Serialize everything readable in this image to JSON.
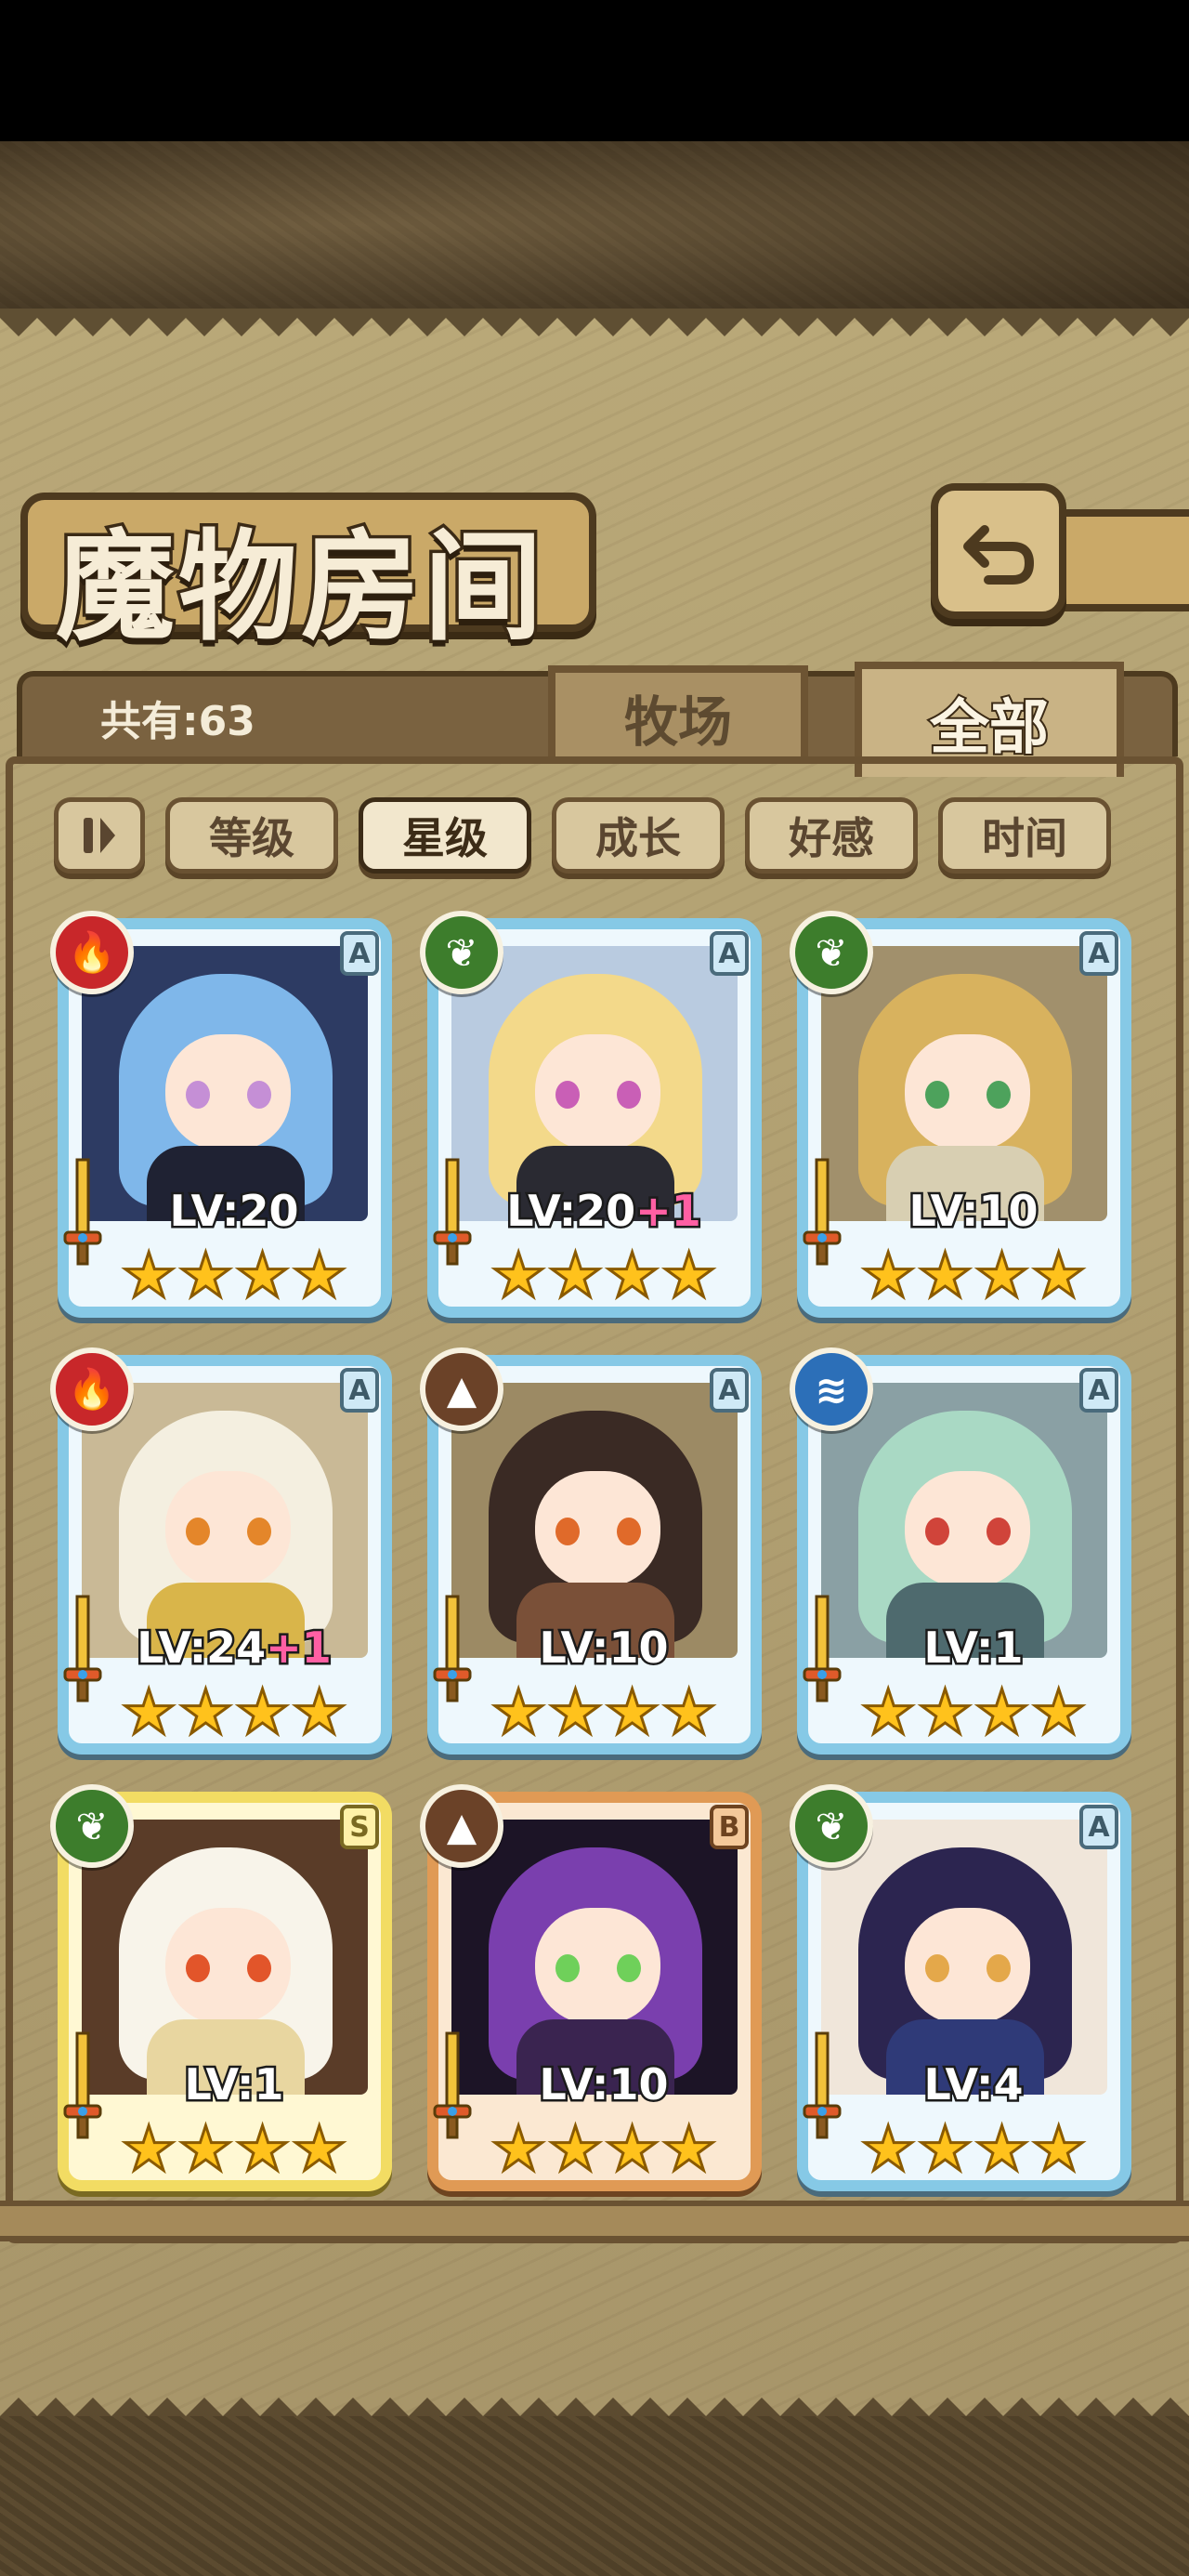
{
  "header": {
    "title": "魔物房间",
    "back_icon": "back-arrow-icon"
  },
  "tabs": {
    "count_label": "共有:63",
    "pasture_label": "牧场",
    "all_label": "全部"
  },
  "filters": {
    "sort_icon": "pause-sort-icon",
    "items": [
      "等级",
      "星级",
      "成长",
      "好感",
      "时间"
    ],
    "active": "星级"
  },
  "cards": [
    {
      "element": "fire",
      "rank": "A",
      "level": "LV:20",
      "plus": "",
      "stars": 4,
      "frame": "blue",
      "palette": {
        "hair": "#7fb7ea",
        "bg": "#2d3b63",
        "body": "#1f2233",
        "eye": "#c58fd6"
      }
    },
    {
      "element": "leaf",
      "rank": "A",
      "level": "LV:20",
      "plus": "+1",
      "stars": 4,
      "frame": "blue",
      "palette": {
        "hair": "#f3d98a",
        "bg": "#b9cbe0",
        "body": "#2a2a32",
        "eye": "#c95fb6"
      }
    },
    {
      "element": "leaf",
      "rank": "A",
      "level": "LV:10",
      "plus": "",
      "stars": 4,
      "frame": "blue",
      "palette": {
        "hair": "#d8b25e",
        "bg": "#a1906c",
        "body": "#d8cfb2",
        "eye": "#4da25c"
      }
    },
    {
      "element": "fire",
      "rank": "A",
      "level": "LV:24",
      "plus": "+1",
      "stars": 4,
      "frame": "blue",
      "palette": {
        "hair": "#f4efe0",
        "bg": "#c9b996",
        "body": "#d9b54a",
        "eye": "#e4862a"
      }
    },
    {
      "element": "earth",
      "rank": "A",
      "level": "LV:10",
      "plus": "",
      "stars": 4,
      "frame": "blue",
      "palette": {
        "hair": "#3a2a24",
        "bg": "#9c8a64",
        "body": "#7a5038",
        "eye": "#e06a2a"
      }
    },
    {
      "element": "water",
      "rank": "A",
      "level": "LV:1",
      "plus": "",
      "stars": 4,
      "frame": "blue",
      "palette": {
        "hair": "#a9d9c4",
        "bg": "#8aa0a4",
        "body": "#4e6a6e",
        "eye": "#d0443a"
      }
    },
    {
      "element": "leaf",
      "rank": "S",
      "level": "LV:1",
      "plus": "",
      "stars": 4,
      "frame": "gold",
      "palette": {
        "hair": "#f8f4ea",
        "bg": "#5a3c28",
        "body": "#e8d6a0",
        "eye": "#e2552a"
      }
    },
    {
      "element": "earth",
      "rank": "B",
      "level": "LV:10",
      "plus": "",
      "stars": 4,
      "frame": "bronze",
      "palette": {
        "hair": "#7a3fae",
        "bg": "#1c1426",
        "body": "#3a2450",
        "eye": "#6fd05a"
      }
    },
    {
      "element": "leaf",
      "rank": "A",
      "level": "LV:4",
      "plus": "",
      "stars": 4,
      "frame": "blue",
      "palette": {
        "hair": "#2c2550",
        "bg": "#f0e6da",
        "body": "#2f3a78",
        "eye": "#e4a84a"
      }
    }
  ]
}
